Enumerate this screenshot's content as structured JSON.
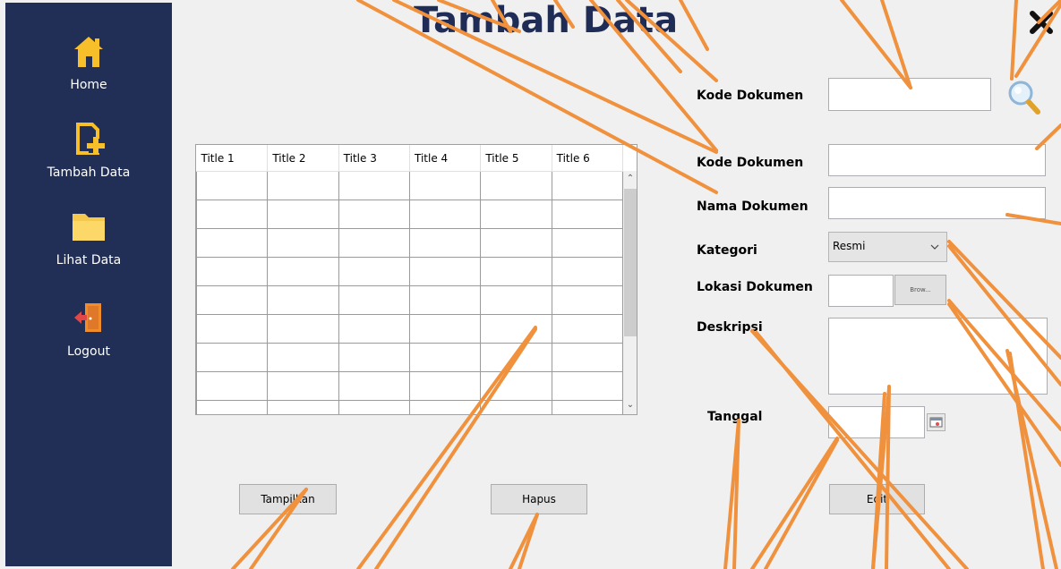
{
  "title": "Tambah Data",
  "sidebar": {
    "items": [
      {
        "label": "Home",
        "icon": "home-icon"
      },
      {
        "label": "Tambah Data",
        "icon": "add-document-icon"
      },
      {
        "label": "Lihat Data",
        "icon": "folder-icon"
      },
      {
        "label": "Logout",
        "icon": "logout-door-icon"
      }
    ]
  },
  "form": {
    "search_label": "Kode Dokumen",
    "search_value": "",
    "kode_label": "Kode Dokumen",
    "kode_value": "",
    "nama_label": "Nama Dokumen",
    "nama_value": "",
    "kategori_label": "Kategori",
    "kategori_value": "Resmi",
    "lokasi_label": "Lokasi Dokumen",
    "lokasi_value": "",
    "browse_label": "Brow...",
    "deskripsi_label": "Deskripsi",
    "deskripsi_value": "",
    "tanggal_label": "Tanggal",
    "tanggal_value": ""
  },
  "table": {
    "columns": [
      "Title 1",
      "Title 2",
      "Title 3",
      "Title 4",
      "Title 5",
      "Title 6"
    ],
    "row_count": 9
  },
  "buttons": {
    "tampilkan": "Tampilkan",
    "hapus": "Hapus",
    "edit": "Edit"
  },
  "colors": {
    "sidebar": "#212e55",
    "title": "#1f2c55",
    "annotation": "#f0913e"
  }
}
